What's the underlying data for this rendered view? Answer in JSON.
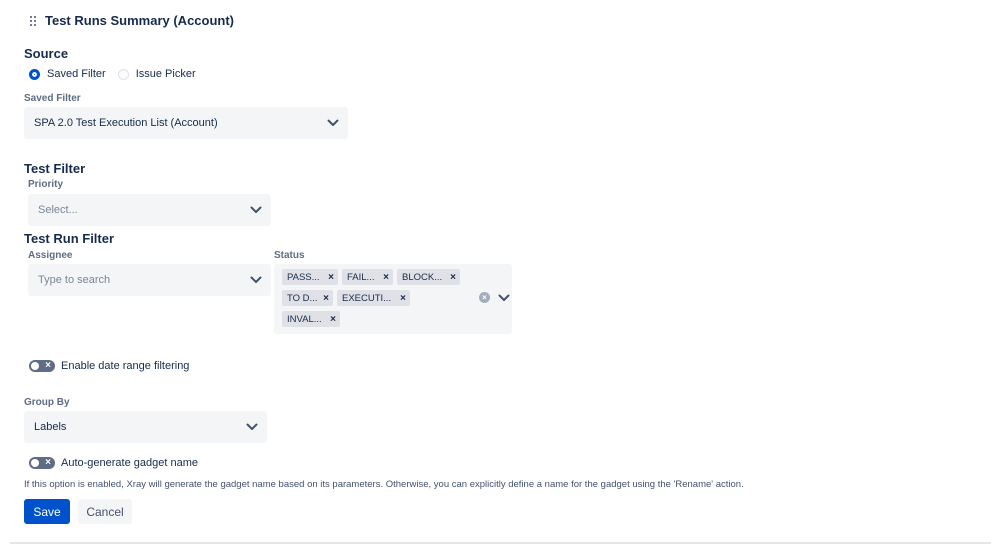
{
  "header": {
    "title": "Test Runs Summary (Account)"
  },
  "source": {
    "title": "Source",
    "options": [
      {
        "label": "Saved Filter",
        "selected": true
      },
      {
        "label": "Issue Picker",
        "selected": false
      }
    ],
    "saved_filter_label": "Saved Filter",
    "saved_filter_value": "SPA 2.0 Test Execution List (Account)"
  },
  "test_filter": {
    "title": "Test Filter",
    "priority_label": "Priority",
    "priority_placeholder": "Select..."
  },
  "test_run_filter": {
    "title": "Test Run Filter",
    "assignee_label": "Assignee",
    "assignee_placeholder": "Type to search",
    "status_label": "Status",
    "status_tags": [
      "PASS...",
      "FAIL...",
      "BLOCK...",
      "TO D...",
      "EXECUTI...",
      "INVAL..."
    ]
  },
  "date_range": {
    "label": "Enable date range filtering",
    "enabled": false
  },
  "group_by": {
    "label": "Group By",
    "value": "Labels"
  },
  "auto_name": {
    "label": "Auto-generate gadget name",
    "enabled": false,
    "help": "If this option is enabled, Xray will generate the gadget name based on its parameters. Otherwise, you can explicitly define a name for the gadget using the 'Rename' action."
  },
  "actions": {
    "save_label": "Save",
    "cancel_label": "Cancel"
  },
  "colors": {
    "primary": "#0052cc",
    "field_bg": "#f4f5f7",
    "tag_bg": "#dfe1e6",
    "text": "#172b4d",
    "subtle_text": "#5e6c84",
    "toggle_off": "#5e6c84"
  },
  "icons": {
    "drag": "drag-handle-icon",
    "chevron": "chevron-down-icon",
    "clear": "clear-icon",
    "remove_tag": "close-icon",
    "toggle_off": "cross-icon"
  }
}
